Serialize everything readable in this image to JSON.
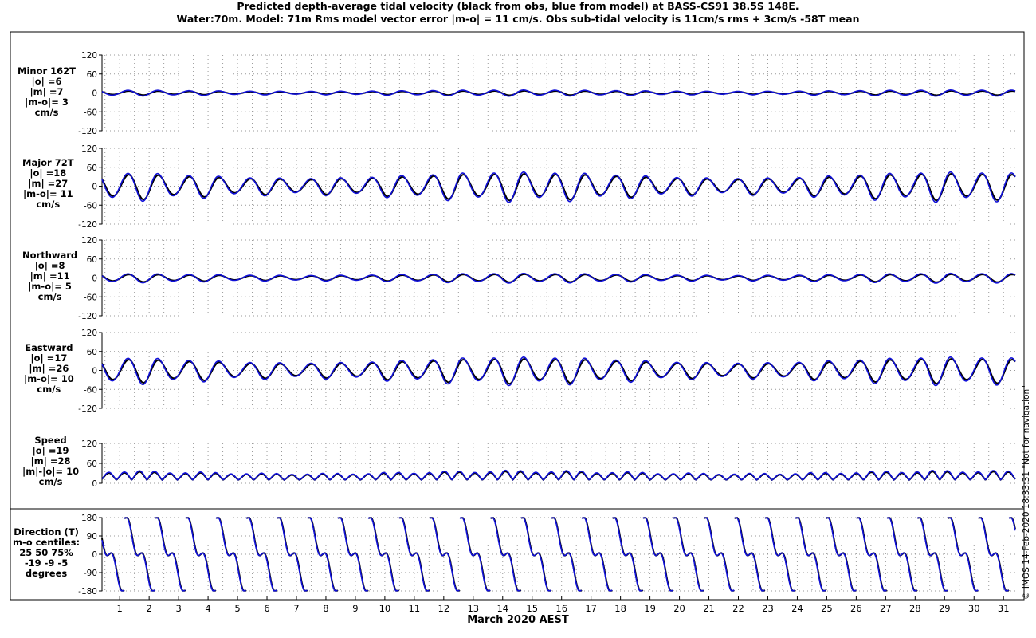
{
  "header": {
    "title_line1": "Predicted depth-average tidal velocity (black from obs, blue from model) at BASS-CS91 38.5S 148E.",
    "title_line2": "Water:70m. Model: 71m  Rms model vector error |m-o| = 11 cm/s. Obs sub-tidal velocity is 11cm/s rms + 3cm/s -58T mean"
  },
  "footer": {
    "xlabel": "March 2020 AEST",
    "credit": "© IMOS 14-Feb-2020 18:33:31  \"Not for navigation\""
  },
  "colors": {
    "obs": "#000000",
    "model": "#1010d8"
  },
  "chart_data": [
    {
      "name": "minor",
      "type": "line",
      "label_lines": [
        "Minor 162T",
        "|o| =6",
        "|m| =7",
        "|m-o|= 3",
        "cm/s"
      ],
      "ylim": [
        -120,
        120
      ],
      "yticks": [
        120,
        60,
        0,
        -60,
        -120
      ],
      "x": {
        "start_day": 0.4,
        "end_day": 31.4,
        "tick_labels": [
          "1",
          "2",
          "3",
          "4",
          "5",
          "6",
          "7",
          "8",
          "9",
          "10",
          "11",
          "12",
          "13",
          "14",
          "15",
          "16",
          "17",
          "18",
          "19",
          "20",
          "21",
          "22",
          "23",
          "24",
          "25",
          "26",
          "27",
          "28",
          "29",
          "30",
          "31"
        ]
      },
      "series": [
        {
          "role": "obs",
          "kind": "tidal",
          "amplitude": 5,
          "offset": 0
        },
        {
          "role": "model",
          "kind": "tidal",
          "amplitude": 7,
          "offset": 0
        }
      ]
    },
    {
      "name": "major",
      "type": "line",
      "label_lines": [
        "Major 72T",
        "|o| =18",
        "|m| =27",
        "|m-o|= 11",
        "cm/s"
      ],
      "ylim": [
        -120,
        120
      ],
      "yticks": [
        120,
        60,
        0,
        -60,
        -120
      ],
      "series": [
        {
          "role": "obs",
          "kind": "tidal",
          "amplitude": 30,
          "offset": 0
        },
        {
          "role": "model",
          "kind": "tidal",
          "amplitude": 34,
          "offset": 0
        }
      ]
    },
    {
      "name": "northward",
      "type": "line",
      "label_lines": [
        "Northward",
        "|o| =8",
        "|m| =11",
        "|m-o|= 5",
        "cm/s"
      ],
      "ylim": [
        -120,
        120
      ],
      "yticks": [
        120,
        60,
        0,
        -60,
        -120
      ],
      "series": [
        {
          "role": "obs",
          "kind": "tidal",
          "amplitude": 9,
          "offset": 0
        },
        {
          "role": "model",
          "kind": "tidal",
          "amplitude": 11,
          "offset": 0
        }
      ]
    },
    {
      "name": "eastward",
      "type": "line",
      "label_lines": [
        "Eastward",
        "|o| =17",
        "|m| =26",
        "|m-o|= 10",
        "cm/s"
      ],
      "ylim": [
        -120,
        120
      ],
      "yticks": [
        120,
        60,
        0,
        -60,
        -120
      ],
      "series": [
        {
          "role": "obs",
          "kind": "tidal",
          "amplitude": 28,
          "offset": 0
        },
        {
          "role": "model",
          "kind": "tidal",
          "amplitude": 32,
          "offset": 0
        }
      ]
    },
    {
      "name": "speed",
      "type": "line",
      "label_lines": [
        "Speed",
        "|o| =19",
        "|m| =28",
        "|m|-|o|= 10",
        "cm/s"
      ],
      "ylim": [
        0,
        120
      ],
      "yticks": [
        120,
        60,
        0
      ],
      "series": [
        {
          "role": "obs",
          "kind": "speed",
          "amplitude": 22,
          "offset": 14
        },
        {
          "role": "model",
          "kind": "speed",
          "amplitude": 26,
          "offset": 14
        }
      ]
    },
    {
      "name": "direction",
      "type": "line",
      "label_lines": [
        "Direction (T)",
        "m-o centiles:",
        "25  50  75%",
        "-19  -9  -5",
        "degrees"
      ],
      "ylim": [
        -180,
        180
      ],
      "yticks": [
        180,
        90,
        0,
        -90,
        -180
      ],
      "series": [
        {
          "role": "obs",
          "kind": "direction"
        },
        {
          "role": "model",
          "kind": "direction"
        }
      ]
    }
  ]
}
